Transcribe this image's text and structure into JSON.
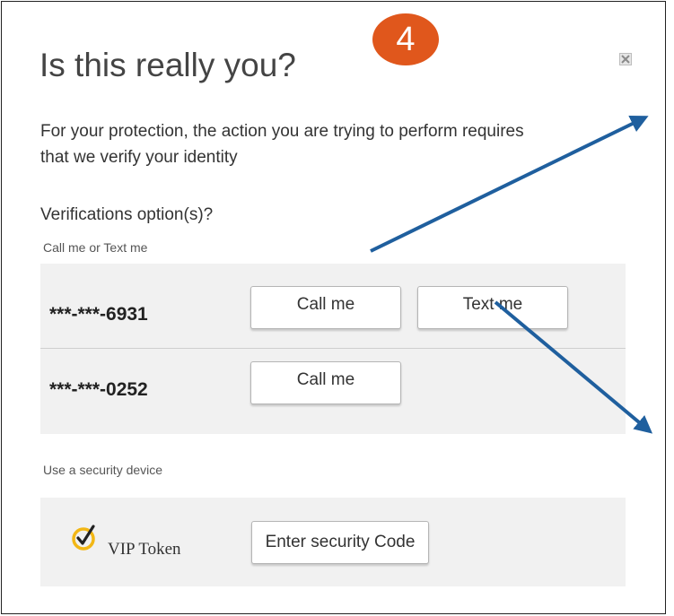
{
  "dialog": {
    "title": "Is this really you?",
    "step_badge": "4",
    "close_icon": "close-icon",
    "description": "For your protection, the action you are trying to perform requires that we verify your identity",
    "verifications_heading": "Verifications option(s)?"
  },
  "call_text_section": {
    "label": "Call me or Text me",
    "phones": [
      {
        "number": "***-***-6931",
        "call_label": "Call me",
        "text_label": "Text me"
      },
      {
        "number": "***-***-0252",
        "call_label": "Call me"
      }
    ]
  },
  "security_device_section": {
    "label": "Use a security device",
    "device_icon": "vip-check-icon",
    "device_name": "VIP Token",
    "button_label": "Enter security Code"
  },
  "colors": {
    "badge": "#e0571c",
    "panel": "#f1f1f1",
    "arrow": "#1f5f9e",
    "vip_check": "#f2b716"
  }
}
